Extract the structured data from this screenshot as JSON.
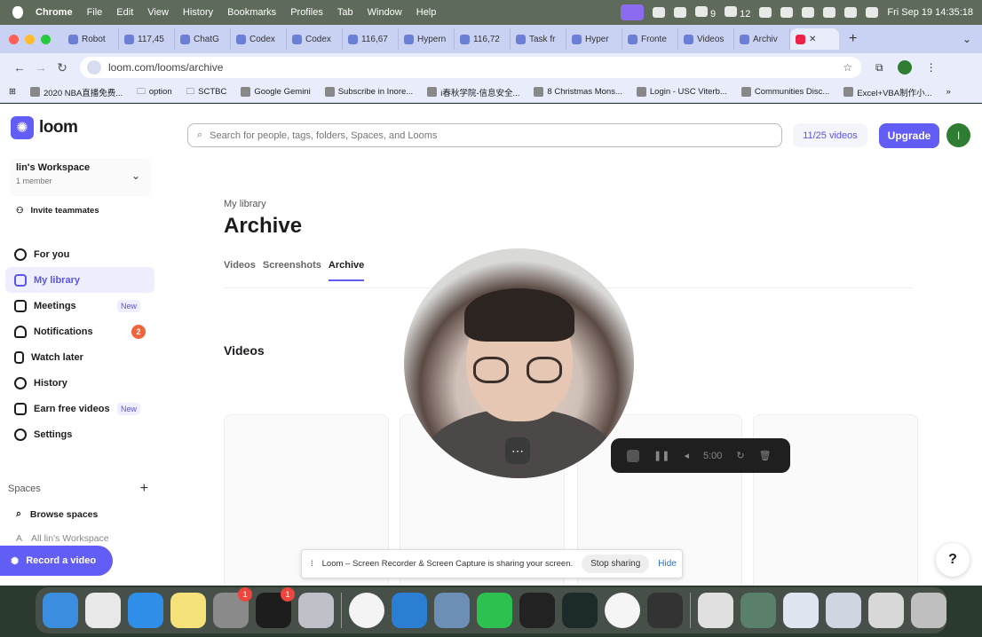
{
  "menubar": {
    "items": [
      "Chrome",
      "File",
      "Edit",
      "View",
      "History",
      "Bookmarks",
      "Profiles",
      "Tab",
      "Window",
      "Help"
    ],
    "battery_pct": "9",
    "wechat_count": "12",
    "clock": "Fri Sep 19  14:35:18"
  },
  "tabs": [
    {
      "label": "Robot"
    },
    {
      "label": "117,45"
    },
    {
      "label": "ChatG"
    },
    {
      "label": "Codex"
    },
    {
      "label": "Codex"
    },
    {
      "label": "116,67"
    },
    {
      "label": "Hypern"
    },
    {
      "label": "116,72"
    },
    {
      "label": "Task fr"
    },
    {
      "label": "Hyper"
    },
    {
      "label": "Fronte"
    },
    {
      "label": "Videos"
    },
    {
      "label": "Archiv"
    }
  ],
  "address": {
    "url": "loom.com/looms/archive"
  },
  "bookmarks": [
    "2020 NBA直播免费...",
    "option",
    "SCTBC",
    "Google Gemini",
    "Subscribe in Inore...",
    "i春秋学院-信息安全...",
    "8 Christmas Mons...",
    "Login - USC Viterb...",
    "Communities Disc...",
    "Excel+VBA制作小..."
  ],
  "sidebar": {
    "logo": "loom",
    "workspace_name": "lin's Workspace",
    "workspace_members": "1 member",
    "invite": "Invite teammates",
    "nav": [
      {
        "label": "For you"
      },
      {
        "label": "My library"
      },
      {
        "label": "Meetings",
        "tag": "New"
      },
      {
        "label": "Notifications",
        "count": "2"
      },
      {
        "label": "Watch later"
      },
      {
        "label": "History"
      },
      {
        "label": "Earn free videos",
        "tag": "New"
      },
      {
        "label": "Settings"
      }
    ],
    "spaces_heading": "Spaces",
    "browse_spaces": "Browse spaces",
    "all_workspace": "All lin's Workspace",
    "record_button": "Record a video"
  },
  "main": {
    "search_placeholder": "Search for people, tags, folders, Spaces, and Looms",
    "usage": "11/25 videos",
    "upgrade": "Upgrade",
    "avatar_initial": "I",
    "breadcrumb": "My library",
    "title": "Archive",
    "tabs": [
      "Videos",
      "Screenshots",
      "Archive"
    ],
    "section_title": "Videos"
  },
  "recorder": {
    "timer": "5:00"
  },
  "share_notice": {
    "message": "Loom – Screen Recorder & Screen Capture is sharing your screen.",
    "stop": "Stop sharing",
    "hide": "Hide"
  },
  "help": "?",
  "dock": {
    "badges": [
      "1",
      "1"
    ]
  },
  "colors": {
    "accent": "#625df5",
    "badge": "#f0643c"
  }
}
